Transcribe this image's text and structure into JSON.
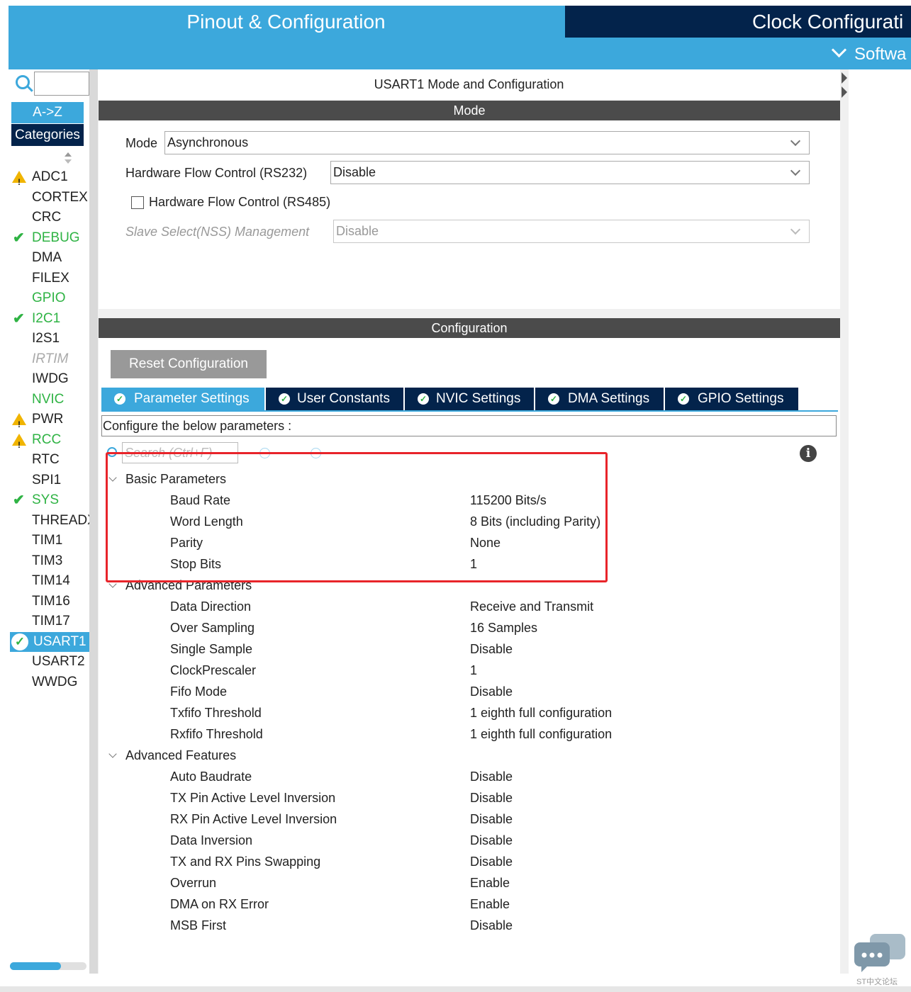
{
  "header": {
    "tab_pinout": "Pinout & Configuration",
    "tab_clock": "Clock Configurati",
    "software_packs": "Softwa"
  },
  "sidebar": {
    "search_placeholder": "",
    "az_label": "A->Z",
    "categories_label": "Categories",
    "items": [
      {
        "label": "ADC1",
        "status": "warning",
        "color": "#222222"
      },
      {
        "label": "CORTEX",
        "status": "none",
        "color": "#222222"
      },
      {
        "label": "CRC",
        "status": "none",
        "color": "#222222"
      },
      {
        "label": "DEBUG",
        "status": "ok",
        "color": "#2fb344"
      },
      {
        "label": "DMA",
        "status": "none",
        "color": "#222222"
      },
      {
        "label": "FILEX",
        "status": "none",
        "color": "#222222"
      },
      {
        "label": "GPIO",
        "status": "none",
        "color": "#2fb344"
      },
      {
        "label": "I2C1",
        "status": "ok",
        "color": "#2fb344"
      },
      {
        "label": "I2S1",
        "status": "none",
        "color": "#222222"
      },
      {
        "label": "IRTIM",
        "status": "none",
        "color": "#aaaaaa"
      },
      {
        "label": "IWDG",
        "status": "none",
        "color": "#222222"
      },
      {
        "label": "NVIC",
        "status": "none",
        "color": "#2fb344"
      },
      {
        "label": "PWR",
        "status": "warning",
        "color": "#222222"
      },
      {
        "label": "RCC",
        "status": "warning",
        "color": "#2fb344"
      },
      {
        "label": "RTC",
        "status": "none",
        "color": "#222222"
      },
      {
        "label": "SPI1",
        "status": "none",
        "color": "#222222"
      },
      {
        "label": "SYS",
        "status": "ok",
        "color": "#2fb344"
      },
      {
        "label": "THREADX",
        "status": "none",
        "color": "#222222"
      },
      {
        "label": "TIM1",
        "status": "none",
        "color": "#222222"
      },
      {
        "label": "TIM3",
        "status": "none",
        "color": "#222222"
      },
      {
        "label": "TIM14",
        "status": "none",
        "color": "#222222"
      },
      {
        "label": "TIM16",
        "status": "none",
        "color": "#222222"
      },
      {
        "label": "TIM17",
        "status": "none",
        "color": "#222222"
      },
      {
        "label": "USART1",
        "status": "selected",
        "color": "#ffffff"
      },
      {
        "label": "USART2",
        "status": "none",
        "color": "#222222"
      },
      {
        "label": "WWDG",
        "status": "none",
        "color": "#222222"
      }
    ]
  },
  "main": {
    "title": "USART1 Mode and Configuration",
    "mode_section": "Mode",
    "mode_label": "Mode",
    "mode_value": "Asynchronous",
    "hfc232_label": "Hardware Flow Control (RS232)",
    "hfc232_value": "Disable",
    "hfc485_label": "Hardware Flow Control (RS485)",
    "nss_label": "Slave Select(NSS) Management",
    "nss_value": "Disable",
    "config_section": "Configuration",
    "reset_button": "Reset Configuration",
    "tabs": [
      {
        "label": "Parameter Settings"
      },
      {
        "label": "User Constants"
      },
      {
        "label": "NVIC Settings"
      },
      {
        "label": "DMA Settings"
      },
      {
        "label": "GPIO Settings"
      }
    ],
    "configure_text": "Configure the below parameters :",
    "search_placeholder": "Search (Ctrl+F)",
    "groups": [
      {
        "title": "Basic Parameters",
        "params": [
          {
            "name": "Baud Rate",
            "value": "115200 Bits/s"
          },
          {
            "name": "Word Length",
            "value": "8 Bits (including Parity)"
          },
          {
            "name": "Parity",
            "value": "None"
          },
          {
            "name": "Stop Bits",
            "value": "1"
          }
        ]
      },
      {
        "title": "Advanced Parameters",
        "params": [
          {
            "name": "Data Direction",
            "value": "Receive and Transmit"
          },
          {
            "name": "Over Sampling",
            "value": "16 Samples"
          },
          {
            "name": "Single Sample",
            "value": "Disable"
          },
          {
            "name": "ClockPrescaler",
            "value": "1"
          },
          {
            "name": "Fifo Mode",
            "value": "Disable"
          },
          {
            "name": "Txfifo Threshold",
            "value": "1 eighth full configuration"
          },
          {
            "name": "Rxfifo Threshold",
            "value": "1 eighth full configuration"
          }
        ]
      },
      {
        "title": "Advanced Features",
        "params": [
          {
            "name": "Auto Baudrate",
            "value": "Disable"
          },
          {
            "name": "TX Pin Active Level Inversion",
            "value": "Disable"
          },
          {
            "name": "RX Pin Active Level Inversion",
            "value": "Disable"
          },
          {
            "name": "Data Inversion",
            "value": "Disable"
          },
          {
            "name": "TX and RX Pins Swapping",
            "value": "Disable"
          },
          {
            "name": "Overrun",
            "value": "Enable"
          },
          {
            "name": "DMA on RX Error",
            "value": "Enable"
          },
          {
            "name": "MSB First",
            "value": "Disable"
          }
        ]
      }
    ]
  },
  "watermark": "ST中文论坛",
  "colors": {
    "accent": "#3ca8dc",
    "navy": "#03234b",
    "ok": "#2fb344",
    "warning": "#f0b400",
    "highlight": "#e8242a"
  }
}
